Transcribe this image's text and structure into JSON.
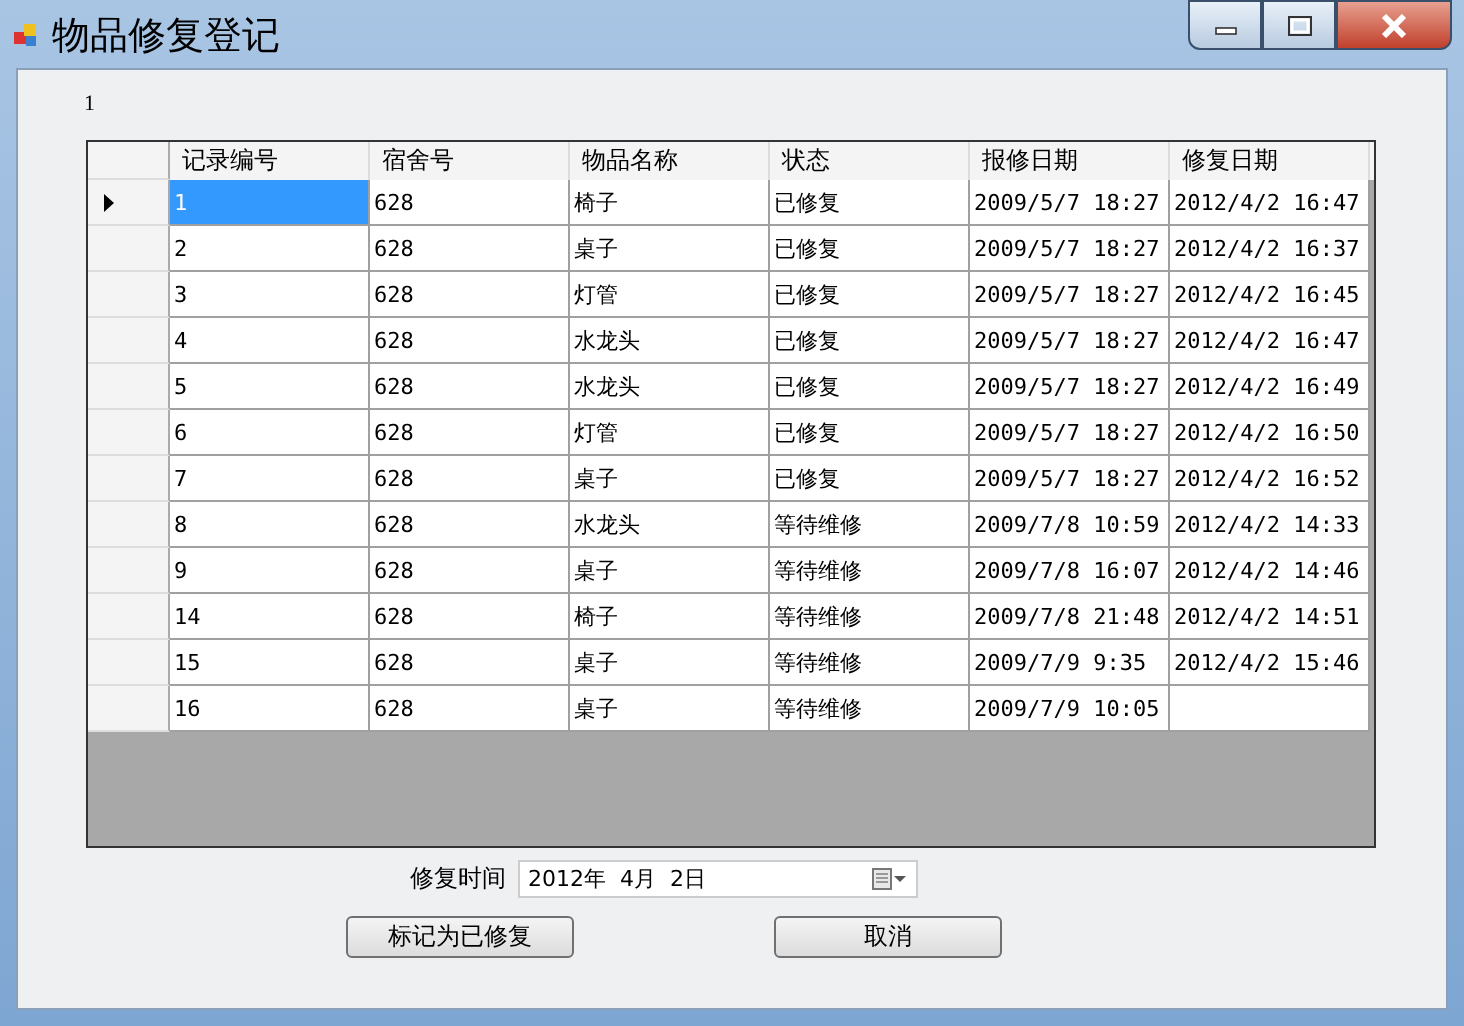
{
  "window": {
    "title": "物品修复登记"
  },
  "label": "1",
  "table": {
    "columns": [
      "记录编号",
      "宿舍号",
      "物品名称",
      "状态",
      "报修日期",
      "修复日期"
    ],
    "rows": [
      {
        "cells": [
          "1",
          "628",
          "椅子",
          "已修复",
          "2009/5/7 18:27",
          "2012/4/2 16:47"
        ],
        "selected": true
      },
      {
        "cells": [
          "2",
          "628",
          "桌子",
          "已修复",
          "2009/5/7 18:27",
          "2012/4/2 16:37"
        ],
        "selected": false
      },
      {
        "cells": [
          "3",
          "628",
          "灯管",
          "已修复",
          "2009/5/7 18:27",
          "2012/4/2 16:45"
        ],
        "selected": false
      },
      {
        "cells": [
          "4",
          "628",
          "水龙头",
          "已修复",
          "2009/5/7 18:27",
          "2012/4/2 16:47"
        ],
        "selected": false
      },
      {
        "cells": [
          "5",
          "628",
          "水龙头",
          "已修复",
          "2009/5/7 18:27",
          "2012/4/2 16:49"
        ],
        "selected": false
      },
      {
        "cells": [
          "6",
          "628",
          "灯管",
          "已修复",
          "2009/5/7 18:27",
          "2012/4/2 16:50"
        ],
        "selected": false
      },
      {
        "cells": [
          "7",
          "628",
          "桌子",
          "已修复",
          "2009/5/7 18:27",
          "2012/4/2 16:52"
        ],
        "selected": false
      },
      {
        "cells": [
          "8",
          "628",
          "水龙头",
          "等待维修",
          "2009/7/8 10:59",
          "2012/4/2 14:33"
        ],
        "selected": false
      },
      {
        "cells": [
          "9",
          "628",
          "桌子",
          "等待维修",
          "2009/7/8 16:07",
          "2012/4/2 14:46"
        ],
        "selected": false
      },
      {
        "cells": [
          "14",
          "628",
          "椅子",
          "等待维修",
          "2009/7/8 21:48",
          "2012/4/2 14:51"
        ],
        "selected": false
      },
      {
        "cells": [
          "15",
          "628",
          "桌子",
          "等待维修",
          "2009/7/9 9:35",
          "2012/4/2 15:46"
        ],
        "selected": false
      },
      {
        "cells": [
          "16",
          "628",
          "桌子",
          "等待维修",
          "2009/7/9 10:05",
          ""
        ],
        "selected": false
      }
    ]
  },
  "date_field": {
    "label": "修复时间",
    "value": "2012年  4月  2日"
  },
  "buttons": [
    "标记为已修复",
    "取消"
  ]
}
